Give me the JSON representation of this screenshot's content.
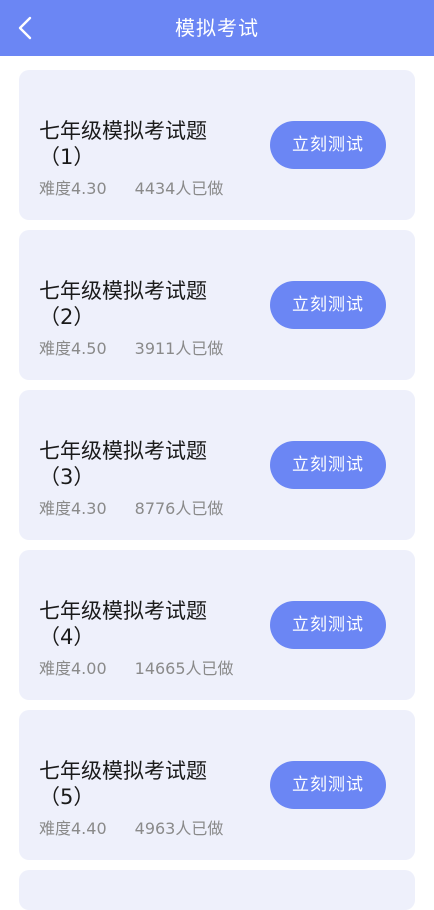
{
  "header": {
    "title": "模拟考试",
    "back_icon": "chevron-left-icon"
  },
  "colors": {
    "accent": "#6b86f4",
    "card_bg": "#eef0fb",
    "meta_text": "#8a8a8a"
  },
  "exams": [
    {
      "title_line1": "七年级模拟考试题",
      "title_line2": "（1）",
      "difficulty": "难度4.30",
      "done_count": "4434人已做",
      "button_label": "立刻测试"
    },
    {
      "title_line1": "七年级模拟考试题",
      "title_line2": "（2）",
      "difficulty": "难度4.50",
      "done_count": "3911人已做",
      "button_label": "立刻测试"
    },
    {
      "title_line1": "七年级模拟考试题",
      "title_line2": "（3）",
      "difficulty": "难度4.30",
      "done_count": "8776人已做",
      "button_label": "立刻测试"
    },
    {
      "title_line1": "七年级模拟考试题",
      "title_line2": "（4）",
      "difficulty": "难度4.00",
      "done_count": "14665人已做",
      "button_label": "立刻测试"
    },
    {
      "title_line1": "七年级模拟考试题",
      "title_line2": "（5）",
      "difficulty": "难度4.40",
      "done_count": "4963人已做",
      "button_label": "立刻测试"
    }
  ]
}
